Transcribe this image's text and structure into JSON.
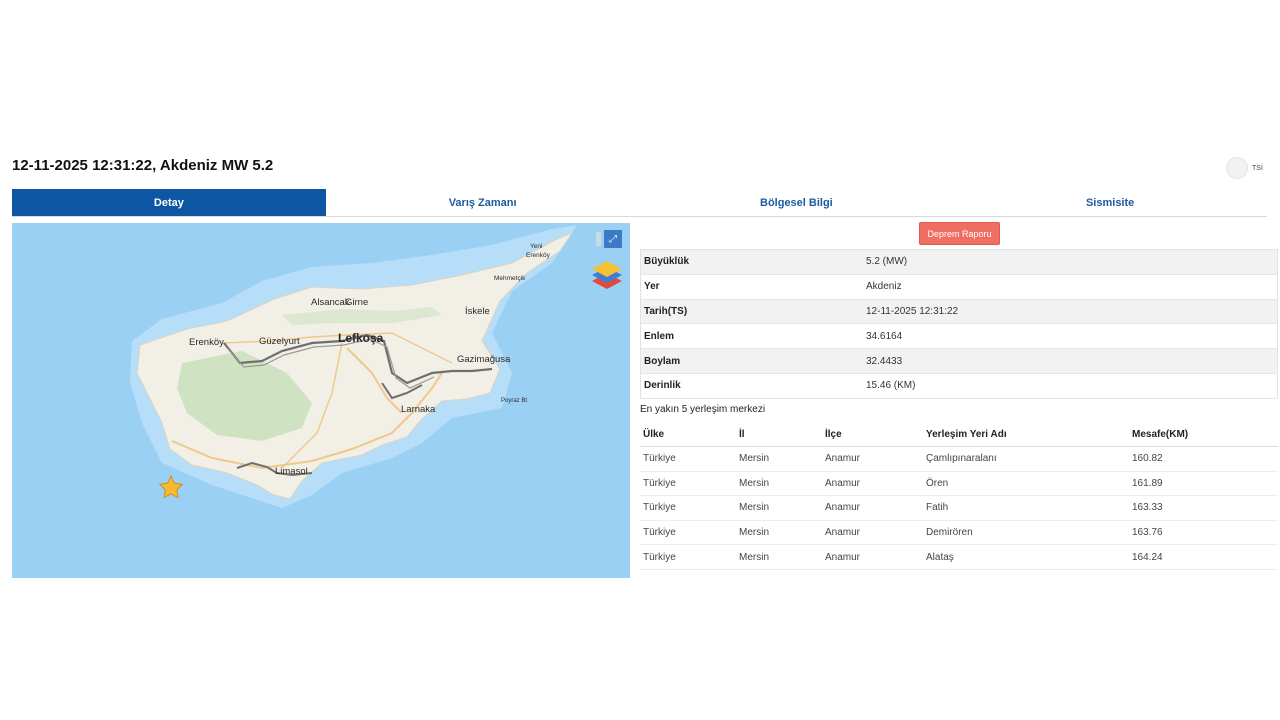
{
  "header": {
    "title": "12-11-2025 12:31:22, Akdeniz MW 5.2",
    "toggle_label": "TSİ"
  },
  "tabs": [
    {
      "label": "Detay"
    },
    {
      "label": "Varış Zamanı"
    },
    {
      "label": "Bölgesel Bilgi"
    },
    {
      "label": "Sismisite"
    }
  ],
  "map": {
    "labels": {
      "lefkosa": "Lefkoşa",
      "girne": "Girne",
      "alsancak": "Alsancak",
      "iskele": "İskele",
      "erenkoy": "Erenköy",
      "guzelyurt": "Güzelyurt",
      "gazimagusa": "Gazimağusa",
      "larnaka": "Larnaka",
      "limasol": "Limasol",
      "yeni_erenkoy_1": "Yeni",
      "yeni_erenkoy_2": "Erenköy",
      "mehmetcik": "Mehmetçik",
      "poyraz": "Poyraz Bt"
    },
    "fullscreen_icon": "expand-icon",
    "layers_icon": "layers-icon",
    "marker_icon": "star-icon",
    "marker_color": "#f5b82e",
    "sea_color": "#9bd0f5"
  },
  "report_button": "Deprem Raporu",
  "info": [
    {
      "key": "Büyüklük",
      "value": "5.2 (MW)"
    },
    {
      "key": "Yer",
      "value": "Akdeniz"
    },
    {
      "key": "Tarih(TS)",
      "value": "12-11-2025 12:31:22"
    },
    {
      "key": "Enlem",
      "value": "34.6164"
    },
    {
      "key": "Boylam",
      "value": "32.4433"
    },
    {
      "key": "Derinlik",
      "value": "15.46 (KM)"
    }
  ],
  "nearest": {
    "title": "En yakın 5 yerleşim merkezi",
    "headers": [
      "Ülke",
      "İl",
      "İlçe",
      "Yerleşim Yeri Adı",
      "Mesafe(KM)"
    ],
    "rows": [
      [
        "Türkiye",
        "Mersin",
        "Anamur",
        "Çamlıpınaralanı",
        "160.82"
      ],
      [
        "Türkiye",
        "Mersin",
        "Anamur",
        "Ören",
        "161.89"
      ],
      [
        "Türkiye",
        "Mersin",
        "Anamur",
        "Fatih",
        "163.33"
      ],
      [
        "Türkiye",
        "Mersin",
        "Anamur",
        "Demirören",
        "163.76"
      ],
      [
        "Türkiye",
        "Mersin",
        "Anamur",
        "Alataş",
        "164.24"
      ]
    ]
  },
  "colors": {
    "tab_active": "#0c56a3",
    "tab_text": "#1e5aa0",
    "report_button": "#ef6e62"
  }
}
